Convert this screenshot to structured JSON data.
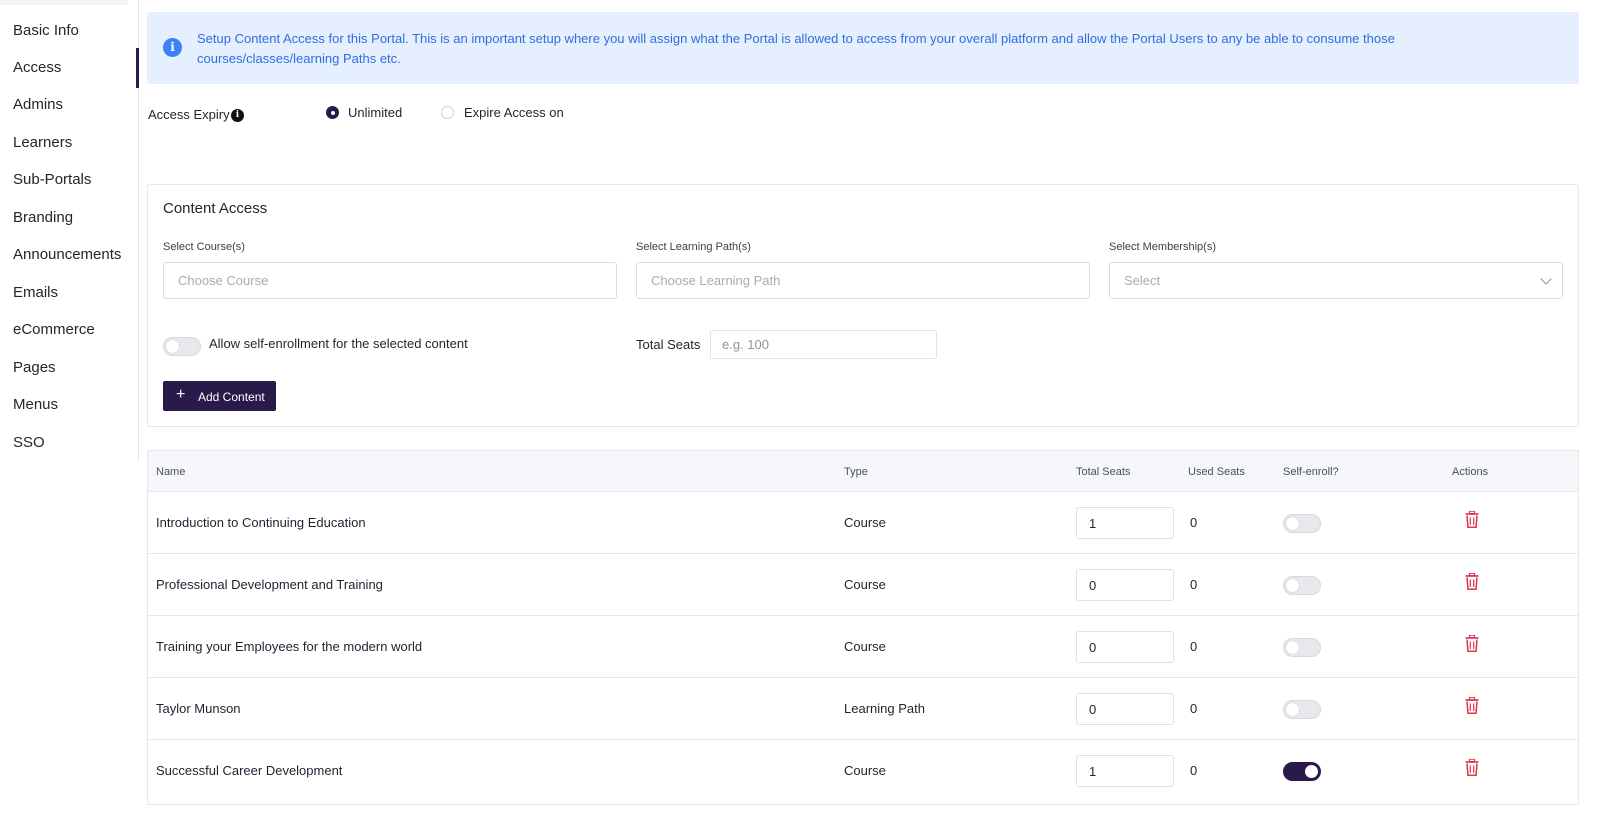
{
  "sidebar": {
    "active_index": 1,
    "items": [
      {
        "label": "Basic Info"
      },
      {
        "label": "Access"
      },
      {
        "label": "Admins"
      },
      {
        "label": "Learners"
      },
      {
        "label": "Sub-Portals"
      },
      {
        "label": "Branding"
      },
      {
        "label": "Announcements"
      },
      {
        "label": "Emails"
      },
      {
        "label": "eCommerce"
      },
      {
        "label": "Pages"
      },
      {
        "label": "Menus"
      },
      {
        "label": "SSO"
      }
    ]
  },
  "banner": {
    "icon": "info-icon",
    "text": "Setup Content Access for this Portal. This is an important setup where you will assign what the Portal is allowed to access from your overall platform and allow the Portal Users to any be able to consume those courses/classes/learning Paths etc."
  },
  "access_expiry": {
    "label": "Access Expiry",
    "options": [
      {
        "label": "Unlimited",
        "selected": true
      },
      {
        "label": "Expire Access on",
        "selected": false
      }
    ]
  },
  "content_access": {
    "title": "Content Access",
    "course_label": "Select Course(s)",
    "course_placeholder": "Choose Course",
    "path_label": "Select Learning Path(s)",
    "path_placeholder": "Choose Learning Path",
    "membership_label": "Select Membership(s)",
    "membership_placeholder": "Select",
    "self_enroll_label": "Allow self-enrollment for the selected content",
    "self_enroll_on": false,
    "total_seats_label": "Total Seats",
    "total_seats_placeholder": "e.g. 100",
    "add_button_label": "Add Content"
  },
  "table": {
    "headers": {
      "name": "Name",
      "type": "Type",
      "total_seats": "Total Seats",
      "used_seats": "Used Seats",
      "self_enroll": "Self-enroll?",
      "actions": "Actions"
    },
    "rows": [
      {
        "name": "Introduction to Continuing Education",
        "type": "Course",
        "total_seats": "1",
        "used_seats": "0",
        "self_enroll": false
      },
      {
        "name": "Professional Development and Training",
        "type": "Course",
        "total_seats": "0",
        "used_seats": "0",
        "self_enroll": false
      },
      {
        "name": "Training your Employees for the modern world",
        "type": "Course",
        "total_seats": "0",
        "used_seats": "0",
        "self_enroll": false
      },
      {
        "name": "Taylor Munson",
        "type": "Learning Path",
        "total_seats": "0",
        "used_seats": "0",
        "self_enroll": false
      },
      {
        "name": "Successful Career Development",
        "type": "Course",
        "total_seats": "1",
        "used_seats": "0",
        "self_enroll": true
      }
    ]
  },
  "colors": {
    "brand": "#2a1a4a",
    "info_bg": "#e6effd",
    "info_text": "#2f6fe0",
    "danger": "#e0324b"
  }
}
